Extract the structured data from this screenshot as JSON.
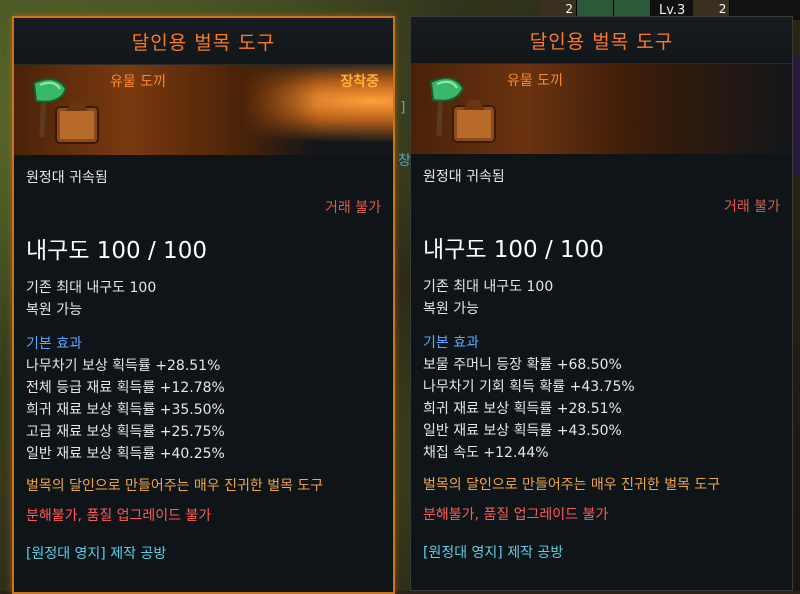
{
  "topbar": {
    "count1": "2",
    "level": "Lv.3",
    "count2": "2"
  },
  "background": {
    "glyph1": "]",
    "glyph2": "창"
  },
  "colors": {
    "title": "#ff7a24",
    "item_type": "#ff8a2a",
    "equipped_badge": "#ffb23a",
    "trade": "#e05a50",
    "section": "#5aa8ff",
    "description": "#f0a64a",
    "restriction": "#ff5a5a",
    "source": "#5ad0e8",
    "equipped_border": "#c8751c"
  },
  "tooltips": [
    {
      "title": "달인용 벌목 도구",
      "item_type": "유물 도끼",
      "equipped_label": "장착중",
      "icon": "axe-icon",
      "bound": "원정대 귀속됨",
      "trade": "거래 불가",
      "durability": "내구도 100 / 100",
      "max_durability": "기존 최대 내구도 100",
      "repairable": "복원 가능",
      "section_label": "기본 효과",
      "effects": [
        "나무차기 보상 획득률 +28.51%",
        "전체 등급 재료 획득률 +12.78%",
        "희귀 재료 보상 획득률 +35.50%",
        "고급 재료 보상 획득률 +25.75%",
        "일반 재료 보상 획득률 +40.25%"
      ],
      "description": "벌목의 달인으로 만들어주는 매우 진귀한 벌목 도구",
      "restriction_a": "분해불가",
      "restriction_sep": ", ",
      "restriction_b": "품질 업그레이드 불가",
      "source": "[원정대 영지] 제작 공방"
    },
    {
      "title": "달인용 벌목 도구",
      "item_type": "유물 도끼",
      "icon": "axe-icon",
      "bound": "원정대 귀속됨",
      "trade": "거래 불가",
      "durability": "내구도 100 / 100",
      "max_durability": "기존 최대 내구도 100",
      "repairable": "복원 가능",
      "section_label": "기본 효과",
      "effects": [
        "보물 주머니 등장 확률 +68.50%",
        "나무차기 기회 획득 확률 +43.75%",
        "희귀 재료 보상 획득률 +28.51%",
        "일반 재료 보상 획득률 +43.50%",
        "채집 속도 +12.44%"
      ],
      "description": "벌목의 달인으로 만들어주는 매우 진귀한 벌목 도구",
      "restriction_a": "분해불가",
      "restriction_sep": ", ",
      "restriction_b": "품질 업그레이드 불가",
      "source": "[원정대 영지] 제작 공방"
    }
  ]
}
